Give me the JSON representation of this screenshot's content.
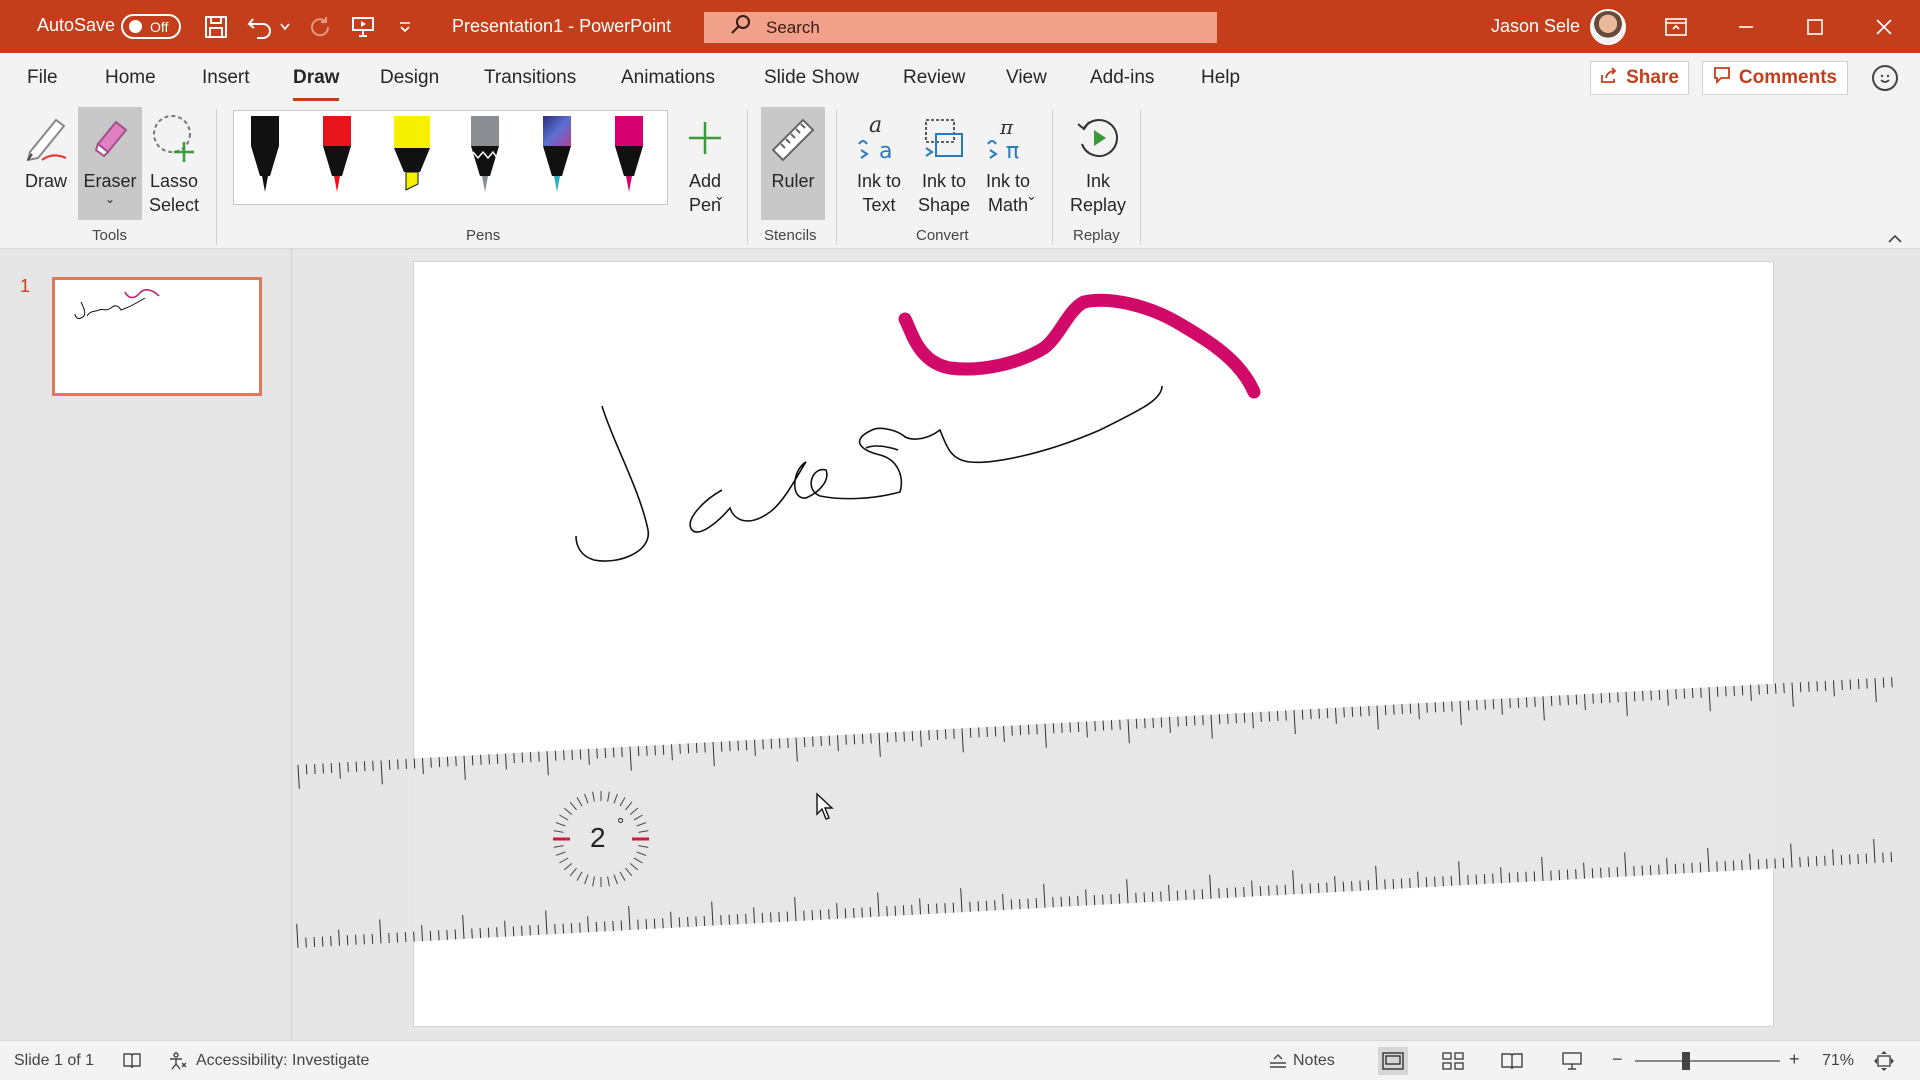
{
  "titlebar": {
    "autosave_label": "AutoSave",
    "autosave_state": "Off",
    "document_title": "Presentation1  -  PowerPoint",
    "search_placeholder": "Search",
    "user_name": "Jason Sele",
    "brand_color": "#c43e1c"
  },
  "tabs": [
    {
      "label": "File"
    },
    {
      "label": "Home"
    },
    {
      "label": "Insert"
    },
    {
      "label": "Draw",
      "active": true
    },
    {
      "label": "Design"
    },
    {
      "label": "Transitions"
    },
    {
      "label": "Animations"
    },
    {
      "label": "Slide Show"
    },
    {
      "label": "Review"
    },
    {
      "label": "View"
    },
    {
      "label": "Add-ins"
    },
    {
      "label": "Help"
    }
  ],
  "header_actions": {
    "share_label": "Share",
    "comments_label": "Comments"
  },
  "ribbon": {
    "tools": {
      "draw_label": "Draw",
      "eraser_label": "Eraser",
      "lasso_line1": "Lasso",
      "lasso_line2": "Select",
      "group_label": "Tools"
    },
    "pens": {
      "items": [
        {
          "name": "black pen",
          "color": "#111111"
        },
        {
          "name": "red pen",
          "color": "#e8141c"
        },
        {
          "name": "yellow highlighter",
          "color": "#f7f000"
        },
        {
          "name": "silver pencil",
          "color": "#8a8d92"
        },
        {
          "name": "galaxy pen",
          "color": "#3a4fb0"
        },
        {
          "name": "magenta pen",
          "color": "#d6006e"
        }
      ],
      "add_pen_line1": "Add",
      "add_pen_line2": "Pen",
      "group_label": "Pens"
    },
    "stencils": {
      "ruler_label": "Ruler",
      "group_label": "Stencils"
    },
    "convert": {
      "ink_to_text_line1": "Ink to",
      "ink_to_text_line2": "Text",
      "ink_to_shape_line1": "Ink to",
      "ink_to_shape_line2": "Shape",
      "ink_to_math_line1": "Ink to",
      "ink_to_math_line2": "Math",
      "group_label": "Convert"
    },
    "replay": {
      "ink_replay_line1": "Ink",
      "ink_replay_line2": "Replay",
      "group_label": "Replay"
    }
  },
  "slide_pane": {
    "slide_number": "1"
  },
  "ruler": {
    "angle_value": "2",
    "angle_unit": "°"
  },
  "statusbar": {
    "slide_info": "Slide 1 of 1",
    "accessibility": "Accessibility: Investigate",
    "notes_label": "Notes",
    "zoom_minus": "−",
    "zoom_plus": "+",
    "zoom_level": "71%"
  },
  "ink_colors": {
    "signature": "#111111",
    "accent_stroke": "#d10a6a"
  }
}
